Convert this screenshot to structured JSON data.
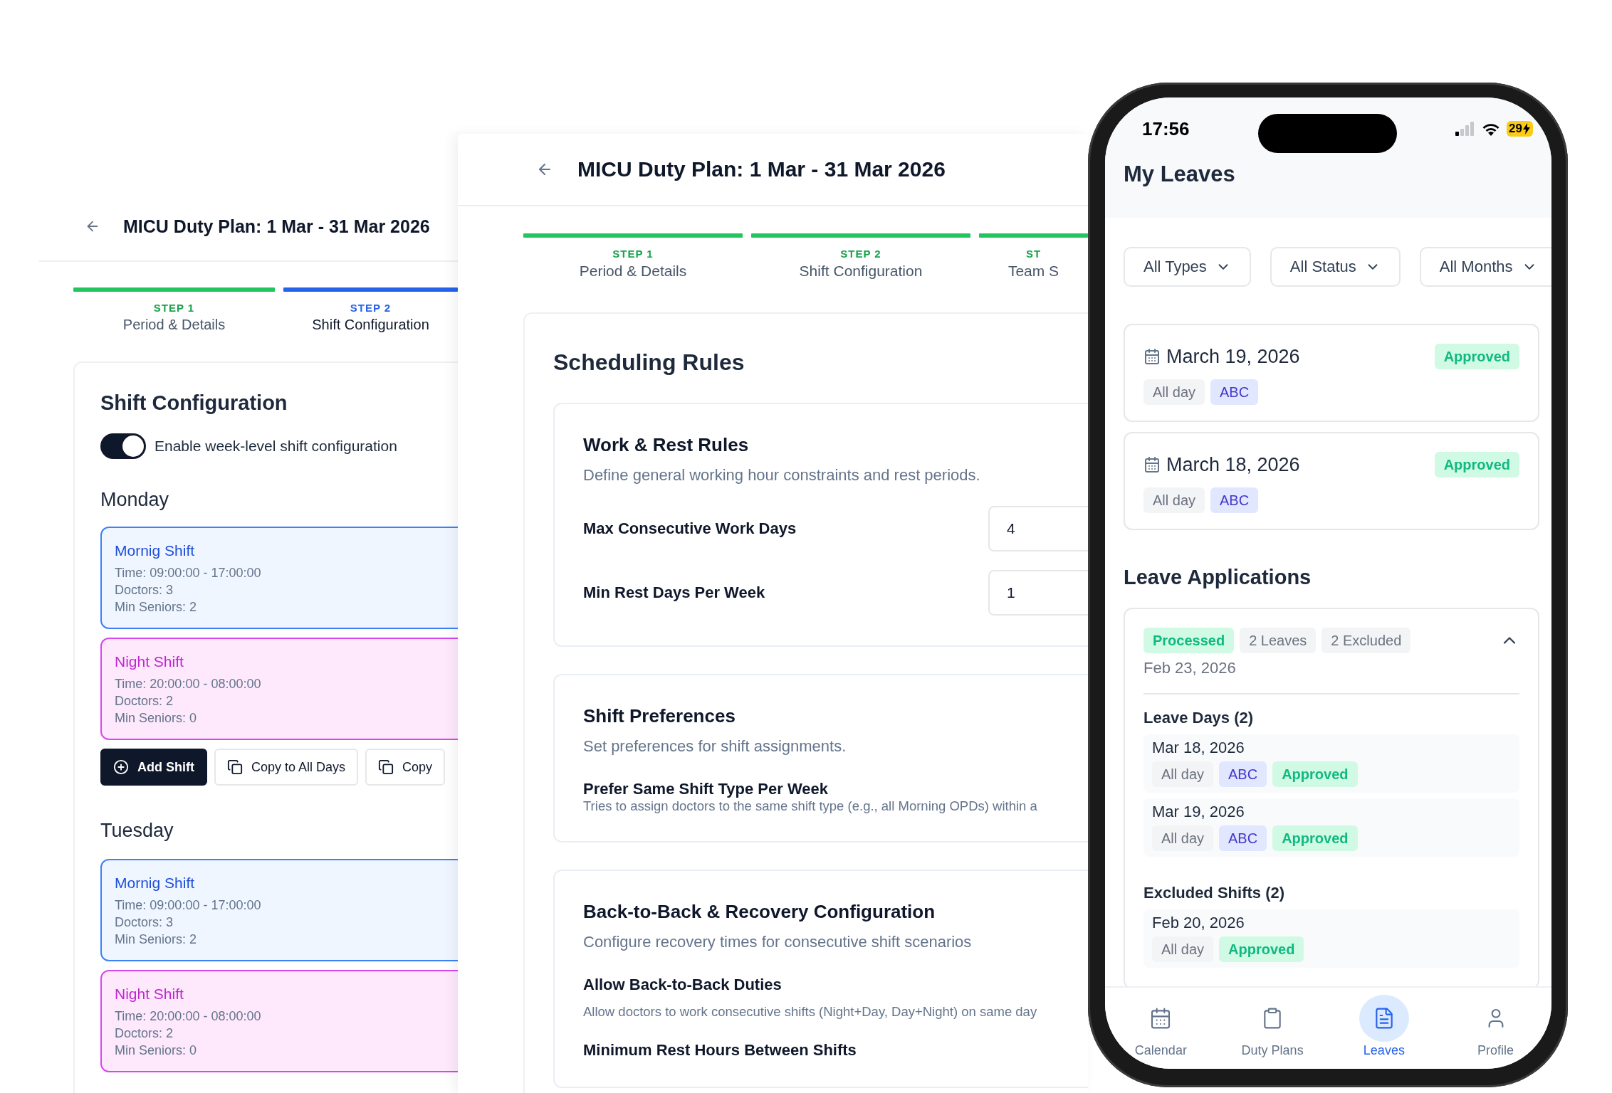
{
  "left_window": {
    "title": "MICU Duty Plan: 1 Mar - 31 Mar 2026",
    "steps": [
      {
        "step": "STEP 1",
        "label": "Period & Details",
        "kind": "complete"
      },
      {
        "step": "STEP 2",
        "label": "Shift Configuration",
        "kind": "current"
      }
    ],
    "panel": {
      "heading": "Shift Configuration",
      "toggle": {
        "label": "Enable week-level shift configuration",
        "on": true
      },
      "days": [
        {
          "name": "Monday",
          "shifts": [
            {
              "kind": "morning",
              "title": "Mornig Shift",
              "lines": [
                "Time: 09:00:00 - 17:00:00",
                "Doctors: 3",
                "Min Seniors: 2"
              ]
            },
            {
              "kind": "night",
              "title": "Night Shift",
              "lines": [
                "Time: 20:00:00 - 08:00:00",
                "Doctors: 2",
                "Min Seniors: 0"
              ]
            }
          ],
          "buttons": [
            {
              "kind": "primary",
              "label": "Add Shift"
            },
            {
              "kind": "secondary",
              "label": "Copy to All Days"
            },
            {
              "kind": "secondary",
              "label": "Copy"
            }
          ]
        },
        {
          "name": "Tuesday",
          "shifts": [
            {
              "kind": "morning",
              "title": "Mornig Shift",
              "lines": [
                "Time: 09:00:00 - 17:00:00",
                "Doctors: 3",
                "Min Seniors: 2"
              ]
            },
            {
              "kind": "night",
              "title": "Night Shift",
              "lines": [
                "Time: 20:00:00 - 08:00:00",
                "Doctors: 2",
                "Min Seniors: 0"
              ]
            }
          ]
        }
      ]
    }
  },
  "middle_window": {
    "title": "MICU Duty Plan: 1 Mar - 31 Mar 2026",
    "steps": [
      {
        "step": "STEP 1",
        "label": "Period & Details",
        "kind": "complete"
      },
      {
        "step": "STEP 2",
        "label": "Shift Configuration",
        "kind": "complete"
      },
      {
        "step": "ST",
        "label": "Team S",
        "kind": "complete"
      }
    ],
    "panel": {
      "heading": "Scheduling Rules",
      "sections": [
        {
          "title": "Work & Rest Rules",
          "description": "Define general working hour constraints and rest periods.",
          "fields": [
            {
              "kind": "number",
              "label": "Max Consecutive Work Days",
              "value": "4"
            },
            {
              "kind": "number",
              "label": "Min Rest Days Per Week",
              "value": "1"
            }
          ]
        },
        {
          "title": "Shift Preferences",
          "description": "Set preferences for shift assignments.",
          "fields": [
            {
              "kind": "option",
              "label": "Prefer Same Shift Type Per Week",
              "hint": "Tries to assign doctors to the same shift type (e.g., all Morning OPDs) within a"
            }
          ]
        },
        {
          "title": "Back-to-Back & Recovery Configuration",
          "description": "Configure recovery times for consecutive shift scenarios",
          "fields": [
            {
              "kind": "option",
              "label": "Allow Back-to-Back Duties",
              "hint": "Allow doctors to work consecutive shifts (Night+Day, Day+Night) on same day"
            },
            {
              "kind": "option",
              "label": "Minimum Rest Hours Between Shifts"
            }
          ]
        }
      ]
    }
  },
  "phone": {
    "status_bar": {
      "time": "17:56",
      "battery": "29"
    },
    "title": "My Leaves",
    "filters": [
      "All Types",
      "All Status",
      "All Months"
    ],
    "leaves": [
      {
        "date": "March 19, 2026",
        "status": "Approved",
        "tags": [
          {
            "kind": "neutral",
            "text": "All day"
          },
          {
            "kind": "type",
            "text": "ABC"
          }
        ]
      },
      {
        "date": "March 18, 2026",
        "status": "Approved",
        "tags": [
          {
            "kind": "neutral",
            "text": "All day"
          },
          {
            "kind": "type",
            "text": "ABC"
          }
        ]
      }
    ],
    "applications_heading": "Leave Applications",
    "application": {
      "badges": [
        {
          "kind": "status",
          "text": "Processed"
        },
        {
          "kind": "neutral",
          "text": "2 Leaves"
        },
        {
          "kind": "neutral",
          "text": "2 Excluded"
        }
      ],
      "expanded": true,
      "date": "Feb 23, 2026",
      "groups": [
        {
          "title": "Leave Days (2)",
          "items": [
            {
              "date": "Mar 18, 2026",
              "tags": [
                {
                  "kind": "neutral",
                  "text": "All day"
                },
                {
                  "kind": "type",
                  "text": "ABC"
                },
                {
                  "kind": "status",
                  "text": "Approved"
                }
              ]
            },
            {
              "date": "Mar 19, 2026",
              "tags": [
                {
                  "kind": "neutral",
                  "text": "All day"
                },
                {
                  "kind": "type",
                  "text": "ABC"
                },
                {
                  "kind": "status",
                  "text": "Approved"
                }
              ]
            }
          ]
        },
        {
          "title": "Excluded Shifts (2)",
          "items": [
            {
              "date": "Feb 20, 2026",
              "tags": [
                {
                  "kind": "neutral",
                  "text": "All day"
                },
                {
                  "kind": "status",
                  "text": "Approved"
                }
              ]
            }
          ]
        }
      ]
    },
    "nav": [
      {
        "label": "Calendar",
        "selected": false
      },
      {
        "label": "Duty Plans",
        "selected": false
      },
      {
        "label": "Leaves",
        "selected": true
      },
      {
        "label": "Profile",
        "selected": false
      }
    ]
  }
}
